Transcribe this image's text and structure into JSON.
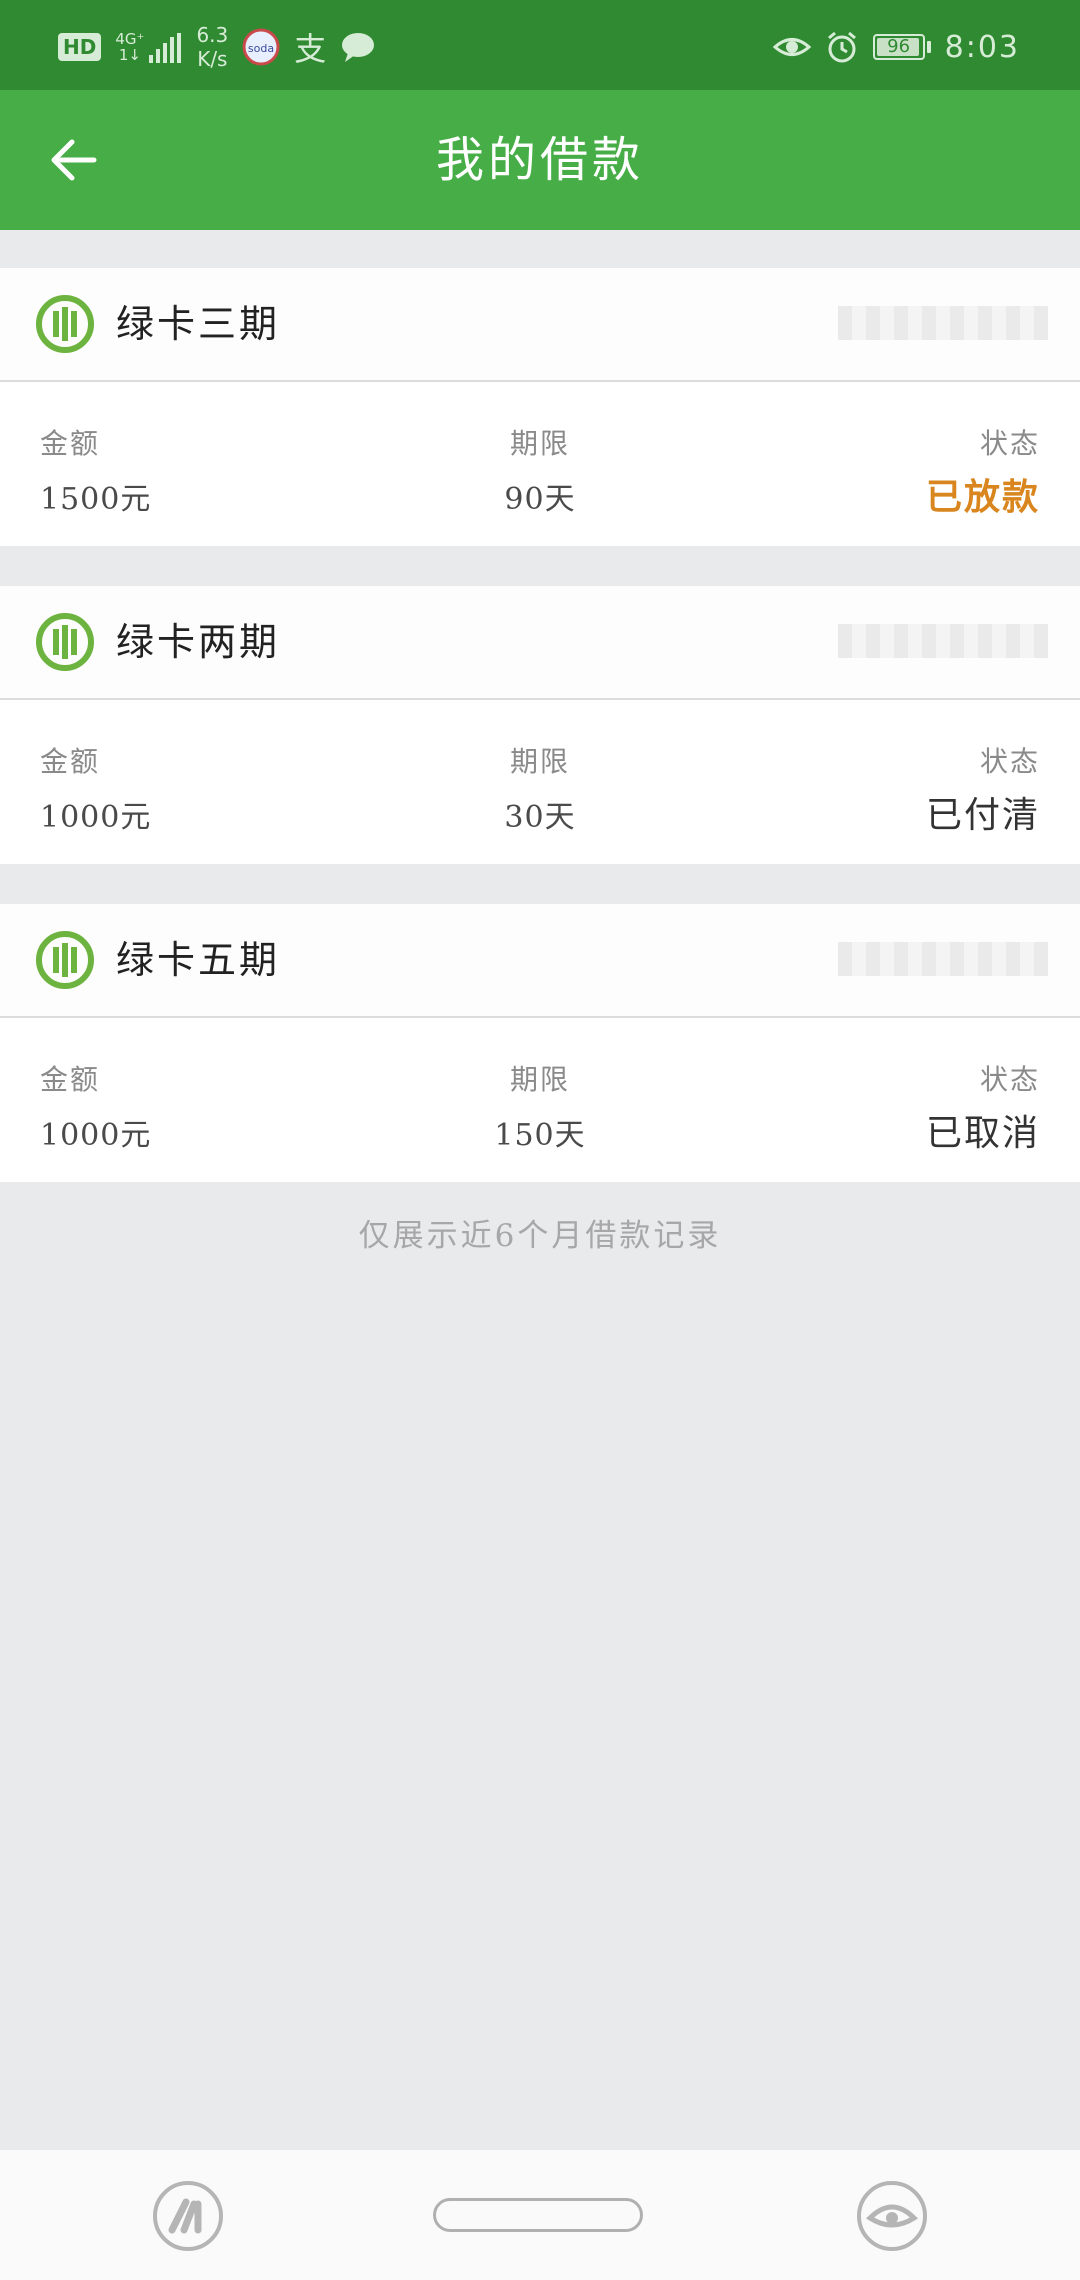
{
  "status_bar": {
    "hd": "HD",
    "network": "4G⁺",
    "network_sub": "1↓",
    "speed_value": "6.3",
    "speed_unit": "K/s",
    "app_icon_label": "soda",
    "alipay_char": "支",
    "battery": "96",
    "battery_level": 0.96,
    "time": "8:03"
  },
  "app_bar": {
    "title": "我的借款"
  },
  "loans": [
    {
      "name": "绿卡三期",
      "amount_label": "金额",
      "amount": "1500元",
      "term_label": "期限",
      "term": "90天",
      "status_label": "状态",
      "status": "已放款",
      "status_highlight": true
    },
    {
      "name": "绿卡两期",
      "amount_label": "金额",
      "amount": "1000元",
      "term_label": "期限",
      "term": "30天",
      "status_label": "状态",
      "status": "已付清",
      "status_highlight": false
    },
    {
      "name": "绿卡五期",
      "amount_label": "金额",
      "amount": "1000元",
      "term_label": "期限",
      "term": "150天",
      "status_label": "状态",
      "status": "已取消",
      "status_highlight": false
    }
  ],
  "footnote": "仅展示近6个月借款记录",
  "colors": {
    "status_bar": "#2f8a32",
    "app_bar": "#46ad47",
    "status_active": "#d9861e",
    "logo_green": "#6cb33f"
  }
}
